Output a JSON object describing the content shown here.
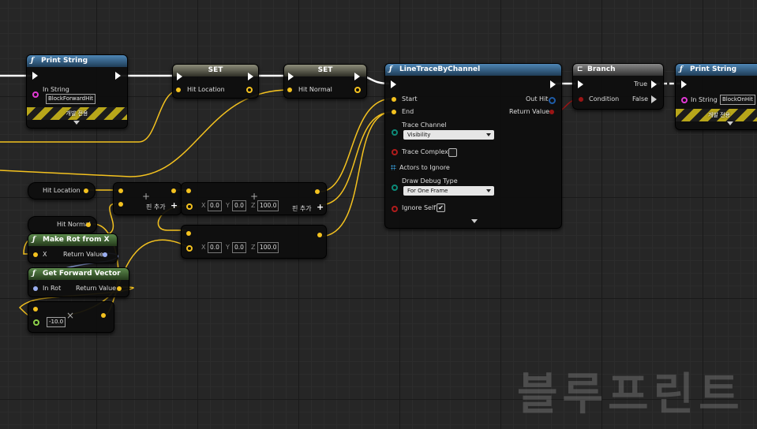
{
  "nodes": {
    "print_string_1": {
      "title": "Print String",
      "in_string_label": "In String",
      "in_string_value": "BlockForwardHit",
      "dev_only": "개발 전용"
    },
    "set_hit_location": {
      "title": "SET",
      "pin_label": "Hit Location"
    },
    "set_hit_normal": {
      "title": "SET",
      "pin_label": "Hit Normal"
    },
    "line_trace": {
      "title": "LineTraceByChannel",
      "start_label": "Start",
      "end_label": "End",
      "out_hit_label": "Out Hit",
      "return_value_label": "Return Value",
      "trace_channel_label": "Trace Channel",
      "trace_channel_value": "Visibility",
      "trace_complex_label": "Trace Complex",
      "actors_to_ignore_label": "Actors to Ignore",
      "draw_debug_label": "Draw Debug Type",
      "draw_debug_value": "For One Frame",
      "ignore_self_label": "Ignore Self",
      "ignore_self_checked": "✔"
    },
    "branch": {
      "title": "Branch",
      "condition_label": "Condition",
      "true_label": "True",
      "false_label": "False"
    },
    "print_string_2": {
      "title": "Print String",
      "in_string_label": "In String",
      "in_string_value": "BlockOnHit",
      "dev_only": "개발 전용"
    },
    "get_hit_location": {
      "label": "Hit Location"
    },
    "get_hit_normal": {
      "label": "Hit Normal"
    },
    "add_node_1": {
      "add_pin_label": "핀 추가",
      "plus": "+"
    },
    "add_node_2": {
      "add_pin_label": "핀 추가",
      "plus": "+",
      "x_label": "X",
      "x_value": "0.0",
      "y_label": "Y",
      "y_value": "0.0",
      "z_label": "Z",
      "z_value": "100.0"
    },
    "subtract_node": {
      "x_label": "X",
      "x_value": "0.0",
      "y_label": "Y",
      "y_value": "0.0",
      "z_label": "Z",
      "z_value": "100.0"
    },
    "make_rot_from_x": {
      "title": "Make Rot from X",
      "x_label": "X",
      "return_value_label": "Return Value"
    },
    "get_forward_vector": {
      "title": "Get Forward Vector",
      "in_rot_label": "In Rot",
      "return_value_label": "Return Value"
    },
    "multiply_node": {
      "value": "-10.0",
      "op": "×"
    }
  },
  "icons": {
    "function_icon": "ƒ",
    "branch_icon": "branch-icon"
  },
  "watermark": "블루프린트",
  "colors": {
    "exec_wire": "#ffffff",
    "vector_wire": "#f4c21f",
    "rotator_wire": "#9aaef0",
    "bool_wire": "#9a1515",
    "function_header": "#2f5a80",
    "pure_header": "#3a5a2d"
  }
}
